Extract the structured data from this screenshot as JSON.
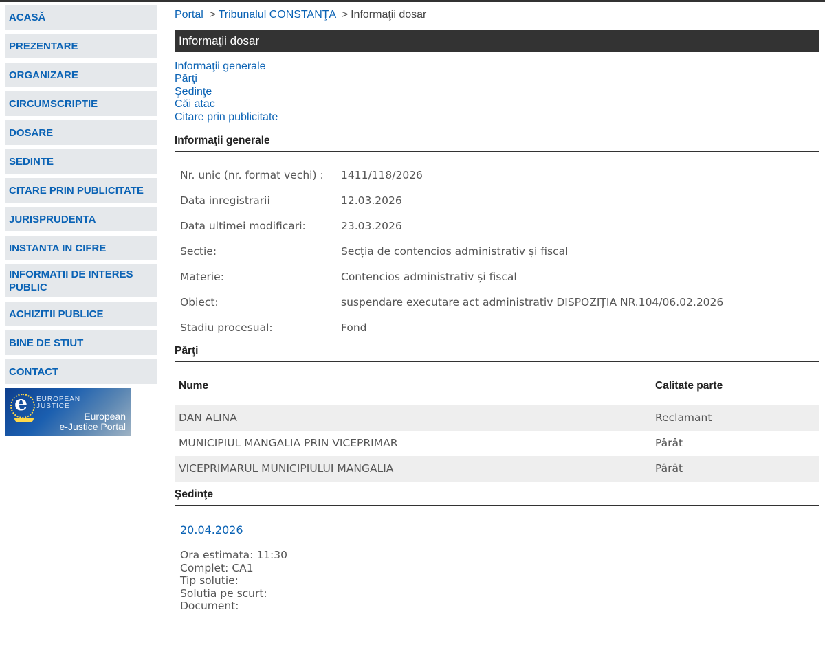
{
  "sidebar": {
    "items": [
      {
        "label": "ACASĂ"
      },
      {
        "label": "PREZENTARE"
      },
      {
        "label": "ORGANIZARE"
      },
      {
        "label": "CIRCUMSCRIPTIE"
      },
      {
        "label": "DOSARE"
      },
      {
        "label": "SEDINTE"
      },
      {
        "label": "CITARE PRIN PUBLICITATE"
      },
      {
        "label": "JURISPRUDENTA"
      },
      {
        "label": "INSTANTA IN CIFRE"
      },
      {
        "label": "INFORMATII DE INTERES PUBLIC"
      },
      {
        "label": "ACHIZITII PUBLICE"
      },
      {
        "label": "BINE DE STIUT"
      },
      {
        "label": "CONTACT"
      }
    ],
    "banner": {
      "small_text_1": "EUROPEAN",
      "small_text_2": "JUSTICE",
      "portal_line_1": "European",
      "portal_line_2": "e-Justice Portal"
    }
  },
  "breadcrumb": {
    "portal": "Portal",
    "separator": ">",
    "court": "Tribunalul CONSTANŢA",
    "current": "Informaţii dosar"
  },
  "page_title": "Informaţii dosar",
  "toc": [
    "Informaţii generale",
    "Părţi",
    "Şedinţe",
    "Căi atac",
    "Citare prin publicitate"
  ],
  "general": {
    "heading": "Informaţii generale",
    "rows": [
      {
        "label": "Nr. unic (nr. format vechi) :",
        "value": "1411/118/2026"
      },
      {
        "label": "Data inregistrarii",
        "value": "12.03.2026"
      },
      {
        "label": "Data ultimei modificari:",
        "value": "23.03.2026"
      },
      {
        "label": "Sectie:",
        "value": "Secția de contencios administrativ și fiscal"
      },
      {
        "label": "Materie:",
        "value": "Contencios administrativ și fiscal"
      },
      {
        "label": "Obiect:",
        "value": "suspendare executare act administrativ DISPOZIȚIA NR.104/06.02.2026"
      },
      {
        "label": "Stadiu procesual:",
        "value": "Fond"
      }
    ]
  },
  "parti": {
    "heading": "Părţi",
    "columns": {
      "name": "Nume",
      "calitate": "Calitate parte"
    },
    "rows": [
      {
        "name": "DAN ALINA",
        "calitate": "Reclamant"
      },
      {
        "name": "MUNICIPIUL MANGALIA PRIN VICEPRIMAR",
        "calitate": "Pârât"
      },
      {
        "name": "VICEPRIMARUL MUNICIPIULUI MANGALIA",
        "calitate": "Pârât"
      }
    ]
  },
  "sedinte": {
    "heading": "Şedinţe",
    "date": "20.04.2026",
    "ora": "Ora estimata: 11:30",
    "complet": "Complet: CA1",
    "tip_solutie": "Tip solutie:",
    "solutia": "Solutia pe scurt:",
    "document": "Document:"
  }
}
